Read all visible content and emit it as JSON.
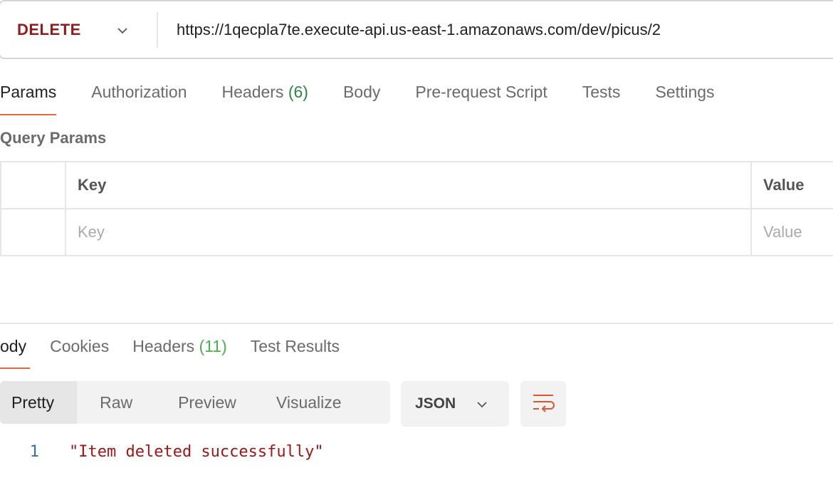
{
  "request": {
    "method": "DELETE",
    "url": "https://1qecpla7te.execute-api.us-east-1.amazonaws.com/dev/picus/2"
  },
  "request_tabs": {
    "params": "Params",
    "authorization": "Authorization",
    "headers_label": "Headers",
    "headers_count": "(6)",
    "body": "Body",
    "pre_request": "Pre-request Script",
    "tests": "Tests",
    "settings": "Settings"
  },
  "query_params": {
    "title": "Query Params",
    "key_header": "Key",
    "value_header": "Value",
    "key_placeholder": "Key",
    "value_placeholder": "Value"
  },
  "response_tabs": {
    "body": "ody",
    "cookies": "Cookies",
    "headers_label": "Headers",
    "headers_count": "(11)",
    "test_results": "Test Results"
  },
  "format": {
    "pretty": "Pretty",
    "raw": "Raw",
    "preview": "Preview",
    "visualize": "Visualize",
    "language": "JSON"
  },
  "response_body": {
    "line_number": "1",
    "content": "\"Item deleted successfully\""
  },
  "colors": {
    "method": "#8f1d1d",
    "accent": "#e8683b",
    "count": "#2e8540",
    "string": "#a31515",
    "line_number": "#3a6ea5"
  },
  "icons": {
    "method_dropdown": "chevron-down-icon",
    "format_dropdown": "chevron-down-icon",
    "wrap": "wrap-lines-icon"
  }
}
